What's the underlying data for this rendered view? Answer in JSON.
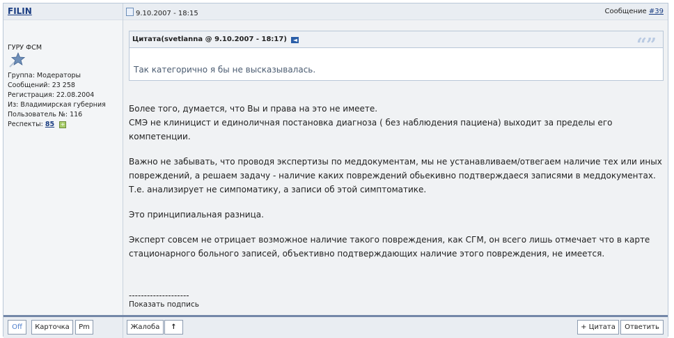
{
  "author": {
    "name": "FILIN",
    "rank": "ГУРУ ФСМ",
    "group": "Группа: Модераторы",
    "posts": "Сообщений: 23 258",
    "registered": "Регистрация: 22.08.2004",
    "from": "Из: Владимирская губерния",
    "user_no": "Пользователь №: 116",
    "respects_label": "Респекты:",
    "respects_value": "85",
    "respect_plus": "+",
    "rank_icon": "star-icon"
  },
  "post": {
    "date": "9.10.2007 - 18:15",
    "message_label": "Сообщение",
    "message_link": "#39",
    "doc_icon": "page-icon",
    "quote": {
      "title": "Цитата(svetlanna @ 9.10.2007 - 18:17)",
      "back_glyph": "◄",
      "marks": "66 99",
      "text": "Так категорично я бы не высказывалась."
    },
    "paragraphs": [
      "Более того, думается, что Вы и права на это не имеете.\nСМЭ не клиницист и единоличная постановка диагноза ( без наблюдения пациена) выходит за пределы его компетенции.",
      "Важно не забывать, что проводя экспертизы по меддокументам, мы не устанавливаем/отвегаем наличие тех или иных повреждений, а решаем задачу - наличие каких повреждений обьекивно подтверждаеся записями в меддокументах.\nТ.е. анализирует не симпоматику, а записи об этой симптоматике.",
      "Это принципиальная разница.",
      "Эксперт совсем не отрицает возможное наличие такого повреждения, как СГМ, он всего лишь отмечает что в карте стационарного больного записей, объективно подтверждающих наличие этого повреждения, не имеется."
    ],
    "signature_separator": "--------------------",
    "show_signature": "Показать подпись"
  },
  "footer": {
    "off": "Off",
    "card": "Карточка",
    "pm": "Pm",
    "complaint": "Жалоба",
    "up": "↑",
    "plus_quote": "+ Цитата",
    "reply": "Ответить"
  }
}
